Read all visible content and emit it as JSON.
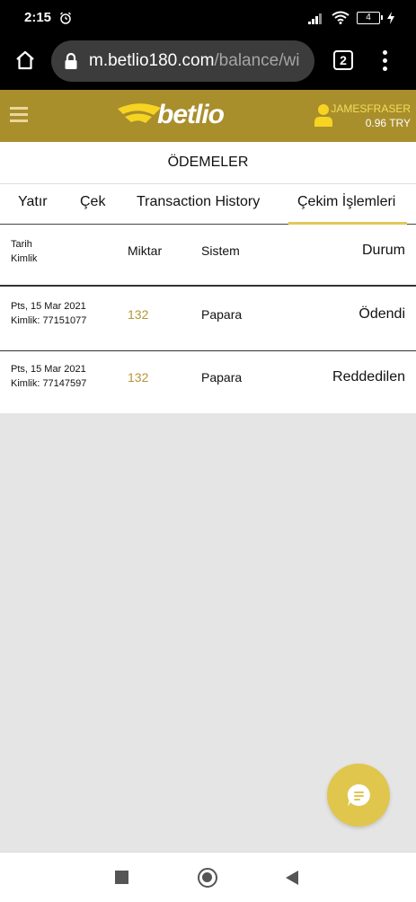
{
  "status_bar": {
    "time": "2:15",
    "battery": "4"
  },
  "browser": {
    "url_host": "m.betlio180.com",
    "url_path": "/balance/wi",
    "tab_count": "2"
  },
  "header": {
    "logo_text": "betlio",
    "username": "JAMESFRASER",
    "balance": "0.96 TRY"
  },
  "page": {
    "title": "ÖDEMELER"
  },
  "tabs": [
    {
      "label": "Yatır"
    },
    {
      "label": "Çek"
    },
    {
      "label": "Transaction History"
    },
    {
      "label": "Çekim İşlemleri",
      "active": true
    }
  ],
  "table": {
    "headers": {
      "date": "Tarih",
      "id": "Kimlik",
      "amount": "Miktar",
      "system": "Sistem",
      "status": "Durum"
    },
    "rows": [
      {
        "date": "Pts, 15 Mar 2021",
        "id": "Kimlik: 77151077",
        "amount": "132",
        "system": "Papara",
        "status": "Ödendi"
      },
      {
        "date": "Pts, 15 Mar 2021",
        "id": "Kimlik: 77147597",
        "amount": "132",
        "system": "Papara",
        "status": "Reddedilen"
      }
    ]
  },
  "colors": {
    "header_bg": "#a98e2c",
    "accent": "#e0c64d",
    "amount": "#b49636"
  },
  "icons": [
    "alarm-icon",
    "signal-icon",
    "wifi-icon",
    "battery-icon",
    "home-icon",
    "lock-icon",
    "more-icon",
    "hamburger-icon",
    "user-icon",
    "chat-icon"
  ]
}
